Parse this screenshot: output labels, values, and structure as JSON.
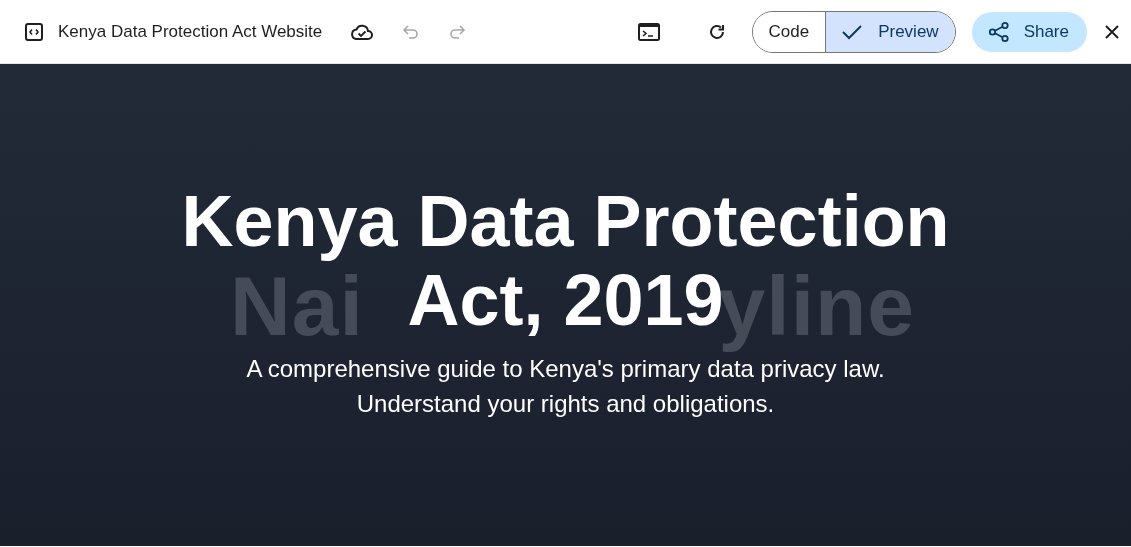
{
  "window": {
    "title": "Kenya Data Protection Act Website"
  },
  "toolbar": {
    "undo": {
      "disabled": true
    },
    "redo": {
      "disabled": true
    },
    "view_toggle": [
      {
        "label": "Code",
        "selected": false
      },
      {
        "label": "Preview",
        "selected": true
      }
    ],
    "share": {
      "label": "Share"
    }
  },
  "hero": {
    "background_text_parts": [
      "Nai",
      "yline"
    ],
    "title_lines": [
      "Kenya Data Protection",
      "Act, 2019"
    ],
    "subtitle": "A comprehensive guide to Kenya's primary data privacy law. Understand your rights and obligations."
  }
}
